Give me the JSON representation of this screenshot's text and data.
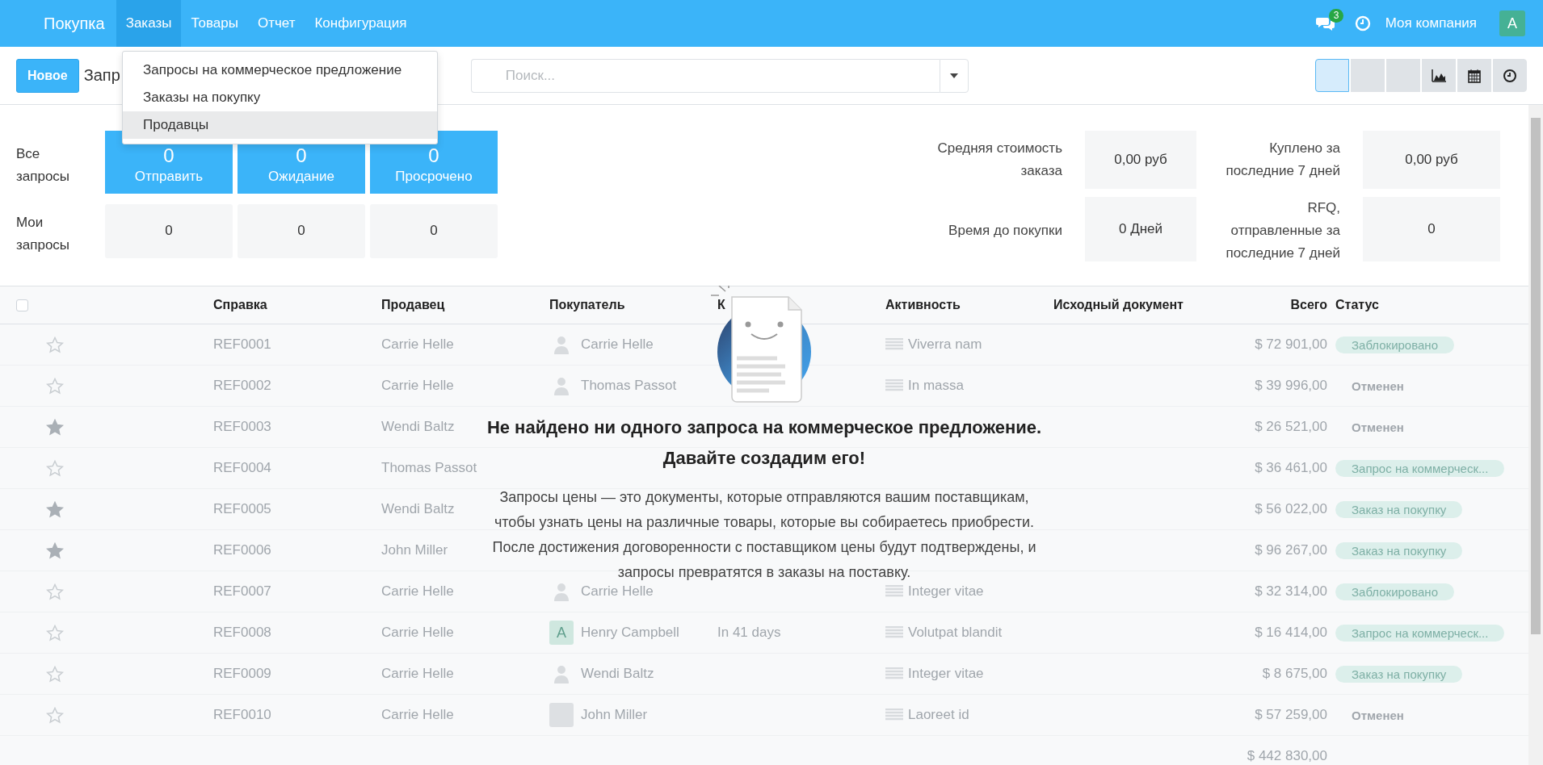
{
  "navbar": {
    "brand": "Покупка",
    "menus": [
      {
        "label": "Заказы",
        "selected": true
      },
      {
        "label": "Товары",
        "selected": false
      },
      {
        "label": "Отчет",
        "selected": false
      },
      {
        "label": "Конфигурация",
        "selected": false
      }
    ],
    "dropdown": [
      {
        "label": "Запросы на коммерческое предложение",
        "selected": false
      },
      {
        "label": "Заказы на покупку",
        "selected": false
      },
      {
        "label": "Продавцы",
        "selected": true
      }
    ],
    "messages_badge": "3",
    "company": "Моя компания",
    "avatar": "A"
  },
  "control_panel": {
    "new_button": "Новое",
    "breadcrumb": "Запр",
    "search": {
      "placeholder": "Поиск..."
    },
    "views": [
      {
        "kind": "blank",
        "selected": true
      },
      {
        "kind": "blank",
        "selected": false
      },
      {
        "kind": "blank",
        "selected": false
      },
      {
        "kind": "graph",
        "selected": false
      },
      {
        "kind": "calendar",
        "selected": false
      },
      {
        "kind": "activity",
        "selected": false
      }
    ]
  },
  "dashboard": {
    "row_labels": [
      "Все запросы",
      "Мои запросы"
    ],
    "all_tiles": [
      {
        "value": "0",
        "label": "Отправить"
      },
      {
        "value": "0",
        "label": "Ожидание"
      },
      {
        "value": "0",
        "label": "Просрочено"
      }
    ],
    "my_tiles": [
      "0",
      "0",
      "0"
    ],
    "stats": [
      {
        "label": "Средняя стоимость заказа",
        "value": "0,00 руб"
      },
      {
        "label": "Куплено за последние 7 дней",
        "value": "0,00 руб"
      },
      {
        "label": "Время до покупки",
        "value": "0 Дней"
      },
      {
        "label": "RFQ, отправленные за последние 7 дней",
        "value": "0"
      }
    ]
  },
  "table": {
    "select_all": {
      "checked": false
    },
    "columns": [
      "Справка",
      "Продавец",
      "Покупатель",
      "К",
      "Активность",
      "Исходный документ",
      "Всего",
      "Статус"
    ],
    "rows": [
      {
        "starred": false,
        "reference": "REF0001",
        "vendor": "Carrie Helle",
        "avatar": {
          "kind": "silhouette"
        },
        "buyer": "Carrie Helle",
        "activity": "Viverra nam",
        "total": "$ 72 901,00",
        "status": {
          "label": "Заблокировано",
          "kind": "pill"
        }
      },
      {
        "starred": false,
        "reference": "REF0002",
        "vendor": "Carrie Helle",
        "avatar": {
          "kind": "silhouette"
        },
        "buyer": "Thomas Passot",
        "activity": "In massa",
        "total": "$ 39 996,00",
        "status": {
          "label": "Отменен",
          "kind": "plain"
        }
      },
      {
        "starred": true,
        "reference": "REF0003",
        "vendor": "Wendi Baltz",
        "total": "$ 26 521,00",
        "status": {
          "label": "Отменен",
          "kind": "plain"
        }
      },
      {
        "starred": false,
        "reference": "REF0004",
        "vendor": "Thomas Passot",
        "total": "$ 36 461,00",
        "status": {
          "label": "Запрос на коммерческ...",
          "kind": "pill"
        }
      },
      {
        "starred": true,
        "reference": "REF0005",
        "vendor": "Wendi Baltz",
        "total": "$ 56 022,00",
        "status": {
          "label": "Заказ на покупку",
          "kind": "pill"
        }
      },
      {
        "starred": true,
        "reference": "REF0006",
        "vendor": "John Miller",
        "total": "$ 96 267,00",
        "status": {
          "label": "Заказ на покупку",
          "kind": "pill"
        }
      },
      {
        "starred": false,
        "reference": "REF0007",
        "vendor": "Carrie Helle",
        "avatar": {
          "kind": "silhouette"
        },
        "buyer": "Carrie Helle",
        "activity": "Integer vitae",
        "total": "$ 32 314,00",
        "status": {
          "label": "Заблокировано",
          "kind": "pill"
        }
      },
      {
        "starred": false,
        "reference": "REF0008",
        "vendor": "Carrie Helle",
        "avatar": {
          "kind": "letter",
          "letter": "A"
        },
        "buyer": "Henry Campbell",
        "deadline": "In 41 days",
        "activity": "Volutpat blandit",
        "total": "$ 16 414,00",
        "status": {
          "label": "Запрос на коммерческ...",
          "kind": "pill"
        }
      },
      {
        "starred": false,
        "reference": "REF0009",
        "vendor": "Carrie Helle",
        "avatar": {
          "kind": "silhouette"
        },
        "buyer": "Wendi Baltz",
        "activity": "Integer vitae",
        "total": "$ 8 675,00",
        "status": {
          "label": "Заказ на покупку",
          "kind": "pill"
        }
      },
      {
        "starred": false,
        "reference": "REF0010",
        "vendor": "Carrie Helle",
        "avatar": {
          "kind": "photo"
        },
        "buyer": "John Miller",
        "activity": "Laoreet id",
        "total": "$ 57 259,00",
        "status": {
          "label": "Отменен",
          "kind": "plain"
        }
      }
    ],
    "sum_total": "$ 442 830,00"
  },
  "empty_help": {
    "title_lines": [
      "Не найдено ни одного запроса на коммерческое предложение.",
      "Давайте создадим его!"
    ],
    "text_lines": [
      "Запросы цены — это документы, которые отправляются вашим поставщикам,",
      "чтобы узнать цены на различные товары, которые вы собираетесь приобрести.",
      "После достижения договоренности с поставщиком цены будут подтверждены, и",
      "запросы превратятся в заказы на поставку."
    ]
  }
}
